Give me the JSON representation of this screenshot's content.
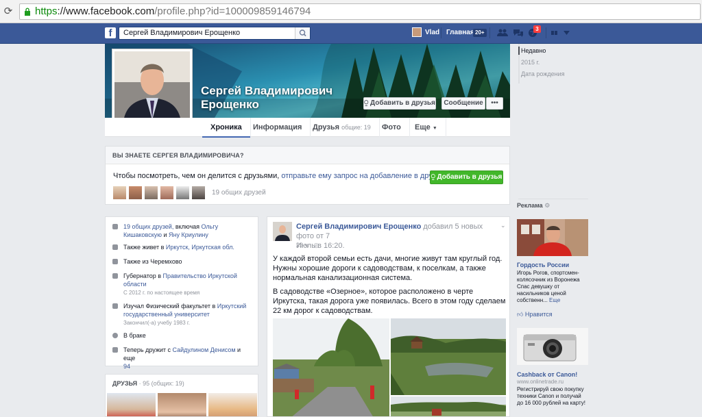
{
  "browser": {
    "url_scheme": "https",
    "url_host": "://www.facebook.com",
    "url_path": "/profile.php?id=100009859146794"
  },
  "topbar": {
    "search_value": "Сергей Владимирович Ерощенко",
    "user_name": "Vlad",
    "home_label": "Главная",
    "home_count": "20+",
    "notification_count": "3"
  },
  "profile": {
    "name_line1": "Сергей Владимирович",
    "name_line2": "Ерощенко",
    "add_friend_label": "Добавить в друзья",
    "message_label": "Сообщение",
    "more_label": "•••"
  },
  "tabs": [
    {
      "label": "Хроника"
    },
    {
      "label": "Информация"
    },
    {
      "label": "Друзья",
      "sub": "общие: 19"
    },
    {
      "label": "Фото"
    },
    {
      "label": "Еще"
    }
  ],
  "timeline_nav": {
    "items": [
      "Недавно",
      "2015 г.",
      "Дата рождения"
    ]
  },
  "know_box": {
    "header": "ВЫ ЗНАЕТЕ СЕРГЕЯ ВЛАДИМИРОВИЧА?",
    "text": "Чтобы посмотреть, чем он делится с друзьями,",
    "link": "отправьте ему запрос на добавление в друзья.",
    "button": "Добавить в друзья",
    "mutual": "19 общих друзей"
  },
  "about": {
    "i1_link": "19 общих друзей,",
    "i1_mid": " включая ",
    "i1_name1": "Ольгу Кишаковскую",
    "i1_and": " и ",
    "i1_name2": "Яну Криулину",
    "i2_text": "Также живет в ",
    "i2_link": "Иркутск, Иркутская обл.",
    "i3_text": "Также из Черемхово",
    "i4_text": "Губернатор в ",
    "i4_link": "Правительство Иркутской области",
    "i4_sub": "С 2012 г. по настоящее время",
    "i5_text": "Изучал Физический факультет в ",
    "i5_link": "Иркутский государственный университет",
    "i5_sub": "Закончил(-а) учебу 1983 г.",
    "i6_text": "В браке",
    "i7_text": "Теперь дружит с ",
    "i7_link": "Сайдулином Денисом",
    "i7_and": " и еще",
    "i7_num": "94"
  },
  "friends_box": {
    "title": "ДРУЗЬЯ",
    "meta": " · 95 (общих: 19)"
  },
  "post": {
    "author": "Сергей Владимирович Ерощенко",
    "action": " добавил 5 новых фото от 7",
    "date_line": "Июль в 16:20.",
    "time": "23 ч · ",
    "p1": "У каждой второй семьи есть дачи, многие живут там круглый год. Нужны хорошие дороги к садоводствам, к поселкам, а также нормальная канализационная система.",
    "p2": "В садоводстве «Озерное», которое расположено в черте Иркутска, такая дорога уже появилась. Всего в этом году сделаем 22 км дорог к садоводствам."
  },
  "ads": {
    "title": "Реклама",
    "ad1_title": "Гордость России",
    "ad1_text": "Игорь Рогов, спортсмен-колясочник из Воронежа Спас девушку от насильников ценой собственн... ",
    "ad1_more": "Еще",
    "ad1_like": "Нравится",
    "ad2_title": "Cashback от Canon!",
    "ad2_site": "www.onlinetrade.ru",
    "ad2_text": "Регистрируй свою покупку техники Canon и получай до 16 000 рублей на карту!"
  },
  "colors": {
    "fb_blue": "#3b5998",
    "green_button": "#42b72a",
    "page_bg": "#e9ebee"
  }
}
